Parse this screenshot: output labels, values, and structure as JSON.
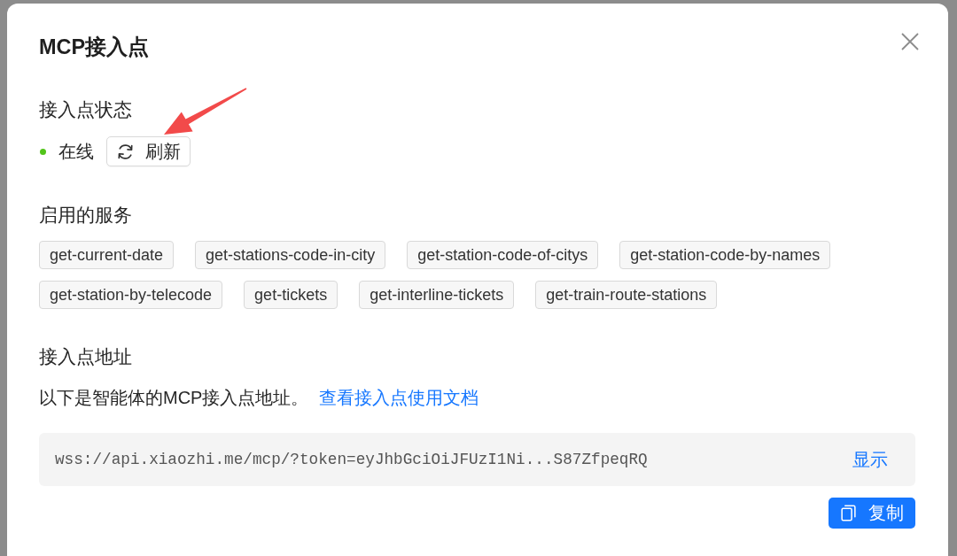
{
  "dialog": {
    "title": "MCP接入点"
  },
  "status_section": {
    "heading": "接入点状态",
    "status": {
      "label": "在线",
      "online": true
    },
    "refresh_button": "刷新"
  },
  "services_section": {
    "heading": "启用的服务",
    "services": [
      "get-current-date",
      "get-stations-code-in-city",
      "get-station-code-of-citys",
      "get-station-code-by-names",
      "get-station-by-telecode",
      "get-tickets",
      "get-interline-tickets",
      "get-train-route-stations"
    ]
  },
  "address_section": {
    "heading": "接入点地址",
    "description": "以下是智能体的MCP接入点地址。",
    "doc_link": "查看接入点使用文档",
    "endpoint": {
      "value": "wss://api.xiaozhi.me/mcp/?token=eyJhbGciOiJFUzI1Ni...S87ZfpeqRQ",
      "show_link": "显示"
    },
    "copy_button": "复制"
  }
}
